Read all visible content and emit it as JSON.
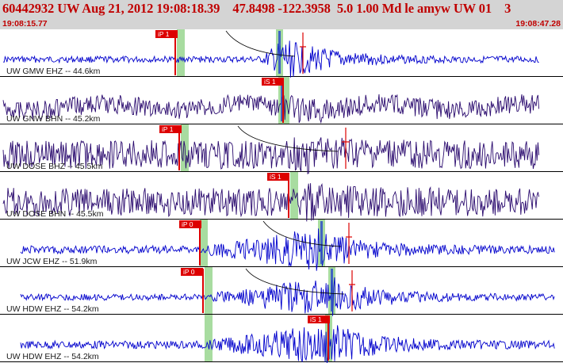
{
  "header": {
    "title": "60442932 UW Aug 21, 2012 19:08:18.39    47.8498 -122.3958  5.0 1.00 Md le amyw UW 01    3",
    "time_start": "19:08:15.77",
    "time_end": "19:08:47.28"
  },
  "colors": {
    "header_bg": "#d4d4d4",
    "title": "#c00000",
    "trace_blue": "#0000cc",
    "trace_purple": "#2a0a6e",
    "pick": "#dd0000",
    "window_green": "#a8dca0",
    "window_blue": "#2f4fc8"
  },
  "traces": [
    {
      "label": "UW GMW EHZ -- 44.6km",
      "color": "blue",
      "pick_label": "iP 1"
    },
    {
      "label": "UW GNW BHN -- 45.2km",
      "color": "purple",
      "pick_label": "iS 1"
    },
    {
      "label": "UW DOSE BHZ -- 45.5km",
      "color": "purple",
      "pick_label": "iP 1"
    },
    {
      "label": "UW DOSE BHN -- 45.5km",
      "color": "purple",
      "pick_label": "iS 1"
    },
    {
      "label": "UW JCW EHZ -- 51.9km",
      "color": "blue",
      "pick_label": "iP 0"
    },
    {
      "label": "UW HDW EHZ -- 54.2km",
      "color": "blue",
      "pick_label": "iP 0"
    },
    {
      "label": "UW HDW EHZ -- 54.2km",
      "color": "blue",
      "pick_label": "iS 1"
    }
  ]
}
